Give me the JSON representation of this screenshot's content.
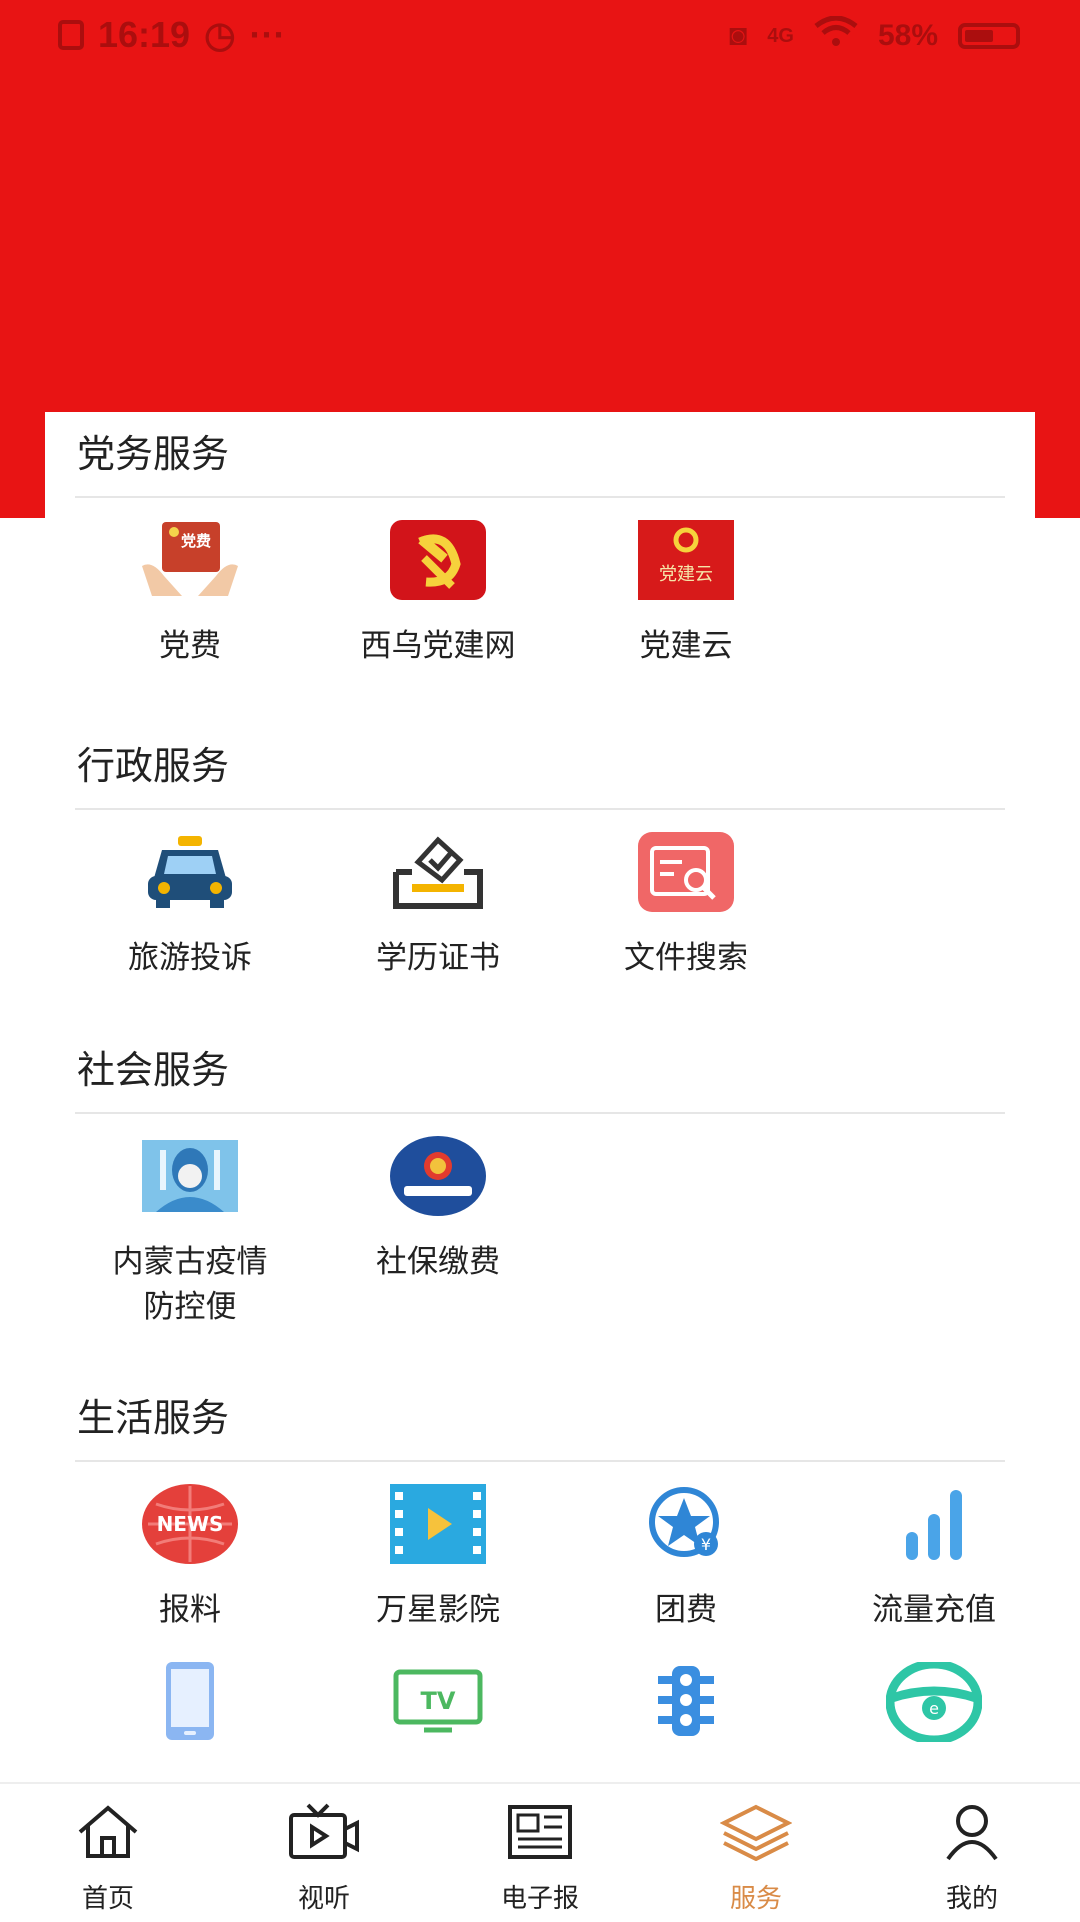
{
  "status_bar": {
    "time": "16:19",
    "dots": "···",
    "network": "4G",
    "battery": "58%"
  },
  "sections": [
    {
      "title": "党务服务",
      "items": [
        {
          "label": "党费",
          "icon": "party-fee-icon"
        },
        {
          "label": "西乌党建网",
          "icon": "party-emblem-icon"
        },
        {
          "label": "党建云",
          "icon": "party-cloud-icon"
        }
      ]
    },
    {
      "title": "行政服务",
      "items": [
        {
          "label": "旅游投诉",
          "icon": "taxi-icon"
        },
        {
          "label": "学历证书",
          "icon": "ballot-box-icon"
        },
        {
          "label": "文件搜索",
          "icon": "document-search-icon"
        }
      ]
    },
    {
      "title": "社会服务",
      "items": [
        {
          "label": "内蒙古疫情防控便",
          "icon": "medical-worker-photo-icon"
        },
        {
          "label": "社保缴费",
          "icon": "social-security-badge-icon"
        }
      ]
    },
    {
      "title": "生活服务",
      "items": [
        {
          "label": "报料",
          "icon": "news-globe-icon"
        },
        {
          "label": "万星影院",
          "icon": "film-play-icon"
        },
        {
          "label": "团费",
          "icon": "star-yuan-icon"
        },
        {
          "label": "流量充值",
          "icon": "signal-bars-icon"
        },
        {
          "label": "",
          "icon": "phone-icon"
        },
        {
          "label": "",
          "icon": "tv-icon"
        },
        {
          "label": "",
          "icon": "traffic-light-icon"
        },
        {
          "label": "",
          "icon": "steering-wheel-icon"
        }
      ]
    }
  ],
  "party_fee_badge": "党费",
  "party_cloud_badge": "党建云",
  "news_badge": "NEWS",
  "tv_badge": "TV",
  "nav": [
    {
      "label": "首页",
      "icon": "home-icon"
    },
    {
      "label": "视听",
      "icon": "video-tv-icon"
    },
    {
      "label": "电子报",
      "icon": "newspaper-icon"
    },
    {
      "label": "服务",
      "icon": "layers-icon",
      "active": true
    },
    {
      "label": "我的",
      "icon": "user-icon"
    }
  ],
  "colors": {
    "header_red": "#E81414",
    "active_nav": "#D98B47"
  }
}
